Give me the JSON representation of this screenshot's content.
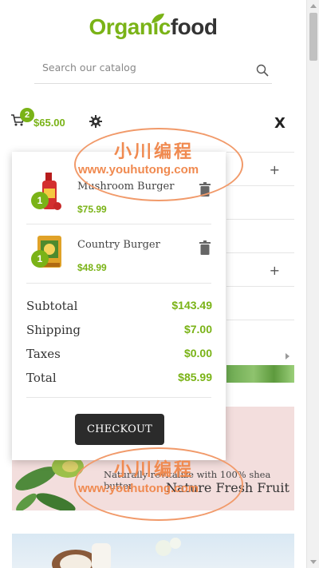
{
  "logo": {
    "part1": "Organic",
    "part2": "food"
  },
  "search": {
    "placeholder": "Search our catalog"
  },
  "header": {
    "cart_count": "2",
    "cart_total": "$65.00",
    "close_label": "X"
  },
  "cart": {
    "items": [
      {
        "qty": "1",
        "name": "Mushroom Burger",
        "price": "$75.99"
      },
      {
        "qty": "1",
        "name": "Country Burger",
        "price": "$48.99"
      }
    ],
    "summary": [
      {
        "label": "Subtotal",
        "value": "$143.49"
      },
      {
        "label": "Shipping",
        "value": "$7.00"
      },
      {
        "label": "Taxes",
        "value": "$0.00"
      },
      {
        "label": "Total",
        "value": "$85.99"
      }
    ],
    "checkout_label": "CHECKOUT"
  },
  "banner": {
    "tagline": "Naturally revitalize with 100% shea butter",
    "headline": "Nature Fresh Fruit"
  },
  "watermark": {
    "cn": "小川编程",
    "url": "www.youhutong.com"
  },
  "colors": {
    "accent": "#7ab317",
    "dark_button": "#2b2b2b",
    "watermark": "#f08a50"
  },
  "icons": [
    "leaf-icon",
    "search-icon",
    "cart-icon",
    "gear-icon",
    "trash-icon",
    "plus-icon"
  ]
}
